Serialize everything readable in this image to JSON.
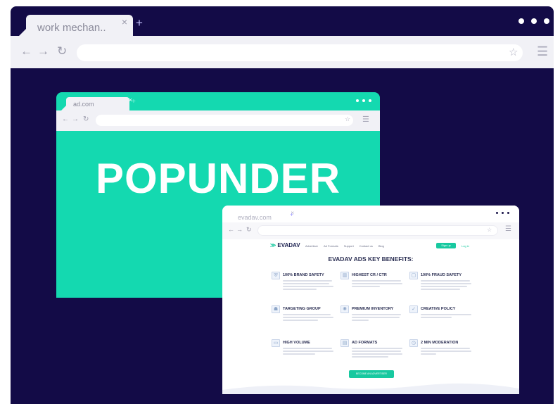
{
  "outer_browser": {
    "tab_title": "work mechan..",
    "close_glyph": "×",
    "new_tab_glyph": "+",
    "back_glyph": "←",
    "forward_glyph": "→",
    "reload_glyph": "↻",
    "star_glyph": "☆",
    "menu_glyph": "☰",
    "background_color": "#130b47"
  },
  "popunder_window": {
    "tab_title": "ad.com",
    "close_glyph": "×",
    "new_tab_glyph": "+",
    "back_glyph": "←",
    "forward_glyph": "→",
    "reload_glyph": "↻",
    "star_glyph": "☆",
    "menu_glyph": "☰",
    "headline": "POPUNDER",
    "background_color": "#14d9b0"
  },
  "evadav_window": {
    "tab_title": "evadav.com",
    "close_glyph": "×",
    "new_tab_glyph": "+",
    "back_glyph": "←",
    "forward_glyph": "→",
    "reload_glyph": "↻",
    "star_glyph": "☆",
    "menu_glyph": "☰",
    "site": {
      "logo": "EVADAV",
      "logo_mark": "≫",
      "nav_links": [
        "Advertiser",
        "Ad Formats",
        "Support",
        "Contact us",
        "Blog"
      ],
      "nav_cta": "Sign up",
      "nav_login": "Log in",
      "benefits_title": "EVADAV ADS KEY BENEFITS:",
      "benefits": [
        {
          "title": "100% BRAND SAFETY",
          "icon": "shield-icon",
          "icon_glyph": "⛨"
        },
        {
          "title": "HIGHEST CR / CTR",
          "icon": "chart-icon",
          "icon_glyph": "▥"
        },
        {
          "title": "100% FRAUD SAFETY",
          "icon": "lock-icon",
          "icon_glyph": "▢"
        },
        {
          "title": "TARGETING GROUP",
          "icon": "group-icon",
          "icon_glyph": "☗"
        },
        {
          "title": "PREMIUM INVENTORY",
          "icon": "sun-icon",
          "icon_glyph": "✺"
        },
        {
          "title": "CREATIVE POLICY",
          "icon": "thumbs-up-icon",
          "icon_glyph": "✓"
        },
        {
          "title": "HIGH VOLUME",
          "icon": "monitor-icon",
          "icon_glyph": "▭"
        },
        {
          "title": "AD FORMATS",
          "icon": "browser-icon",
          "icon_glyph": "▤"
        },
        {
          "title": "2 MIN MODERATION",
          "icon": "clock-icon",
          "icon_glyph": "◷"
        }
      ],
      "cta": "BECOME AN ADVERTISER",
      "accent_color": "#18c9a0"
    }
  }
}
